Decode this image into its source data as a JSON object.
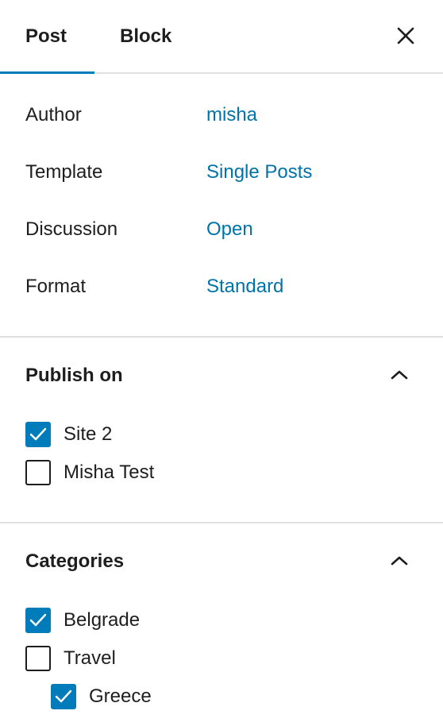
{
  "tabs": {
    "post": "Post",
    "block": "Block"
  },
  "meta": {
    "author": {
      "label": "Author",
      "value": "misha"
    },
    "template": {
      "label": "Template",
      "value": "Single Posts"
    },
    "discussion": {
      "label": "Discussion",
      "value": "Open"
    },
    "format": {
      "label": "Format",
      "value": "Standard"
    }
  },
  "publish": {
    "title": "Publish on",
    "items": [
      {
        "label": "Site 2",
        "checked": true
      },
      {
        "label": "Misha Test",
        "checked": false
      }
    ]
  },
  "categories": {
    "title": "Categories",
    "items": [
      {
        "label": "Belgrade",
        "checked": true
      },
      {
        "label": "Travel",
        "checked": false
      },
      {
        "label": "Greece",
        "checked": true
      }
    ]
  },
  "colors": {
    "accent": "#007cba",
    "link": "#0073aa",
    "text": "#1e1e1e",
    "divider": "#e0e0e0"
  },
  "icons": {
    "close": "close-icon",
    "collapse": "chevron-up-icon",
    "check": "checkmark-icon"
  }
}
